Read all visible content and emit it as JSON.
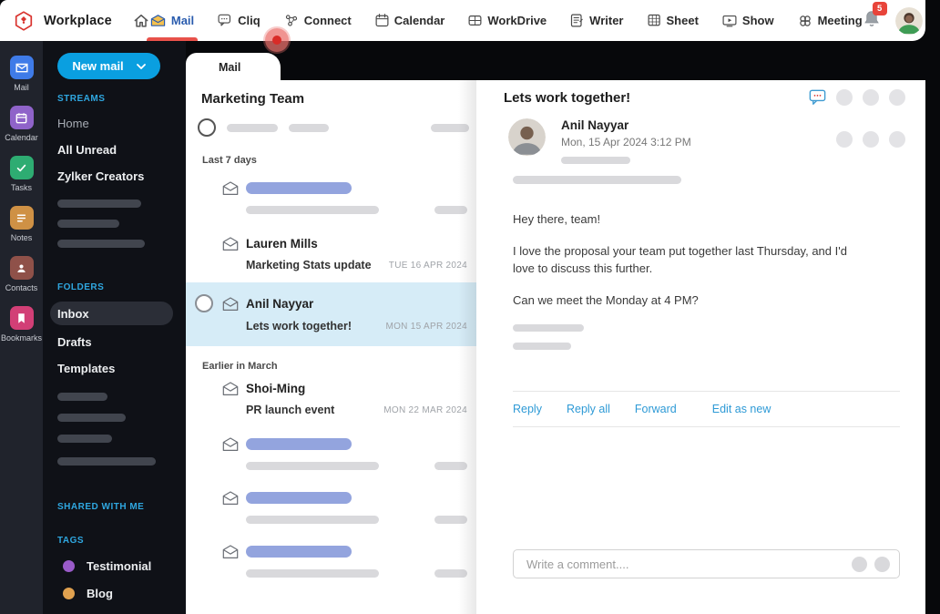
{
  "topbar": {
    "brand": "Workplace",
    "nav": [
      {
        "label": "Mail",
        "active": true
      },
      {
        "label": "Cliq"
      },
      {
        "label": "Connect"
      },
      {
        "label": "Calendar"
      },
      {
        "label": "WorkDrive"
      },
      {
        "label": "Writer"
      },
      {
        "label": "Sheet"
      },
      {
        "label": "Show"
      },
      {
        "label": "Meeting"
      }
    ],
    "notification_count": "5"
  },
  "rail": {
    "items": [
      {
        "label": "Mail",
        "color": "#3f7be8"
      },
      {
        "label": "Calendar",
        "color": "#8f63c9"
      },
      {
        "label": "Tasks",
        "color": "#2eac72"
      },
      {
        "label": "Notes",
        "color": "#cf9145"
      },
      {
        "label": "Contacts",
        "color": "#8f5149"
      },
      {
        "label": "Bookmarks",
        "color": "#d23f76"
      }
    ]
  },
  "sidebar": {
    "new_mail_label": "New mail",
    "streams": {
      "title": "STREAMS",
      "items": [
        "Home",
        "All Unread",
        "Zylker Creators"
      ]
    },
    "folders": {
      "title": "FOLDERS",
      "items": [
        "Inbox",
        "Drafts",
        "Templates"
      ],
      "selected": "Inbox"
    },
    "shared_title": "SHARED WITH ME",
    "tags": {
      "title": "TAGS",
      "items": [
        {
          "label": "Testimonial",
          "color": "#9a5bc9"
        },
        {
          "label": "Blog",
          "color": "#e0a14f"
        }
      ]
    }
  },
  "list": {
    "tab_label": "Mail",
    "title": "Marketing Team",
    "groups": [
      "Last 7 days",
      "Earlier in March"
    ],
    "emails": [
      {
        "sender": "Lauren Mills",
        "subject": "Marketing Stats update",
        "date": "TUE 16 APR 2024"
      },
      {
        "sender": "Anil Nayyar",
        "subject": "Lets work together!",
        "date": "MON 15 APR 2024",
        "selected": true
      },
      {
        "sender": "Shoi-Ming",
        "subject": "PR launch event",
        "date": "MON 22 MAR 2024"
      }
    ]
  },
  "reader": {
    "subject": "Lets work together!",
    "sender": "Anil Nayyar",
    "datetime": "Mon, 15 Apr 2024  3:12 PM",
    "body": [
      "Hey there, team!",
      "I love the proposal your team put together last Thursday, and I'd love to discuss this further.",
      "Can we meet the Monday at 4 PM?"
    ],
    "actions": [
      "Reply",
      "Reply all",
      "Forward",
      "Edit as new"
    ],
    "comment_placeholder": "Write a comment...."
  },
  "colors": {
    "accent_blue": "#0a9fe0",
    "nav_active_blue": "#2a5cae",
    "underline_red": "#e8514a",
    "badge_red": "#e8443a",
    "selected_row": "#d6ecf7",
    "skeleton_blue": "#93a4de",
    "skeleton_gray": "#d9d9dc",
    "link_blue": "#2e9ad6",
    "section_label_blue": "#2fa7e0"
  }
}
